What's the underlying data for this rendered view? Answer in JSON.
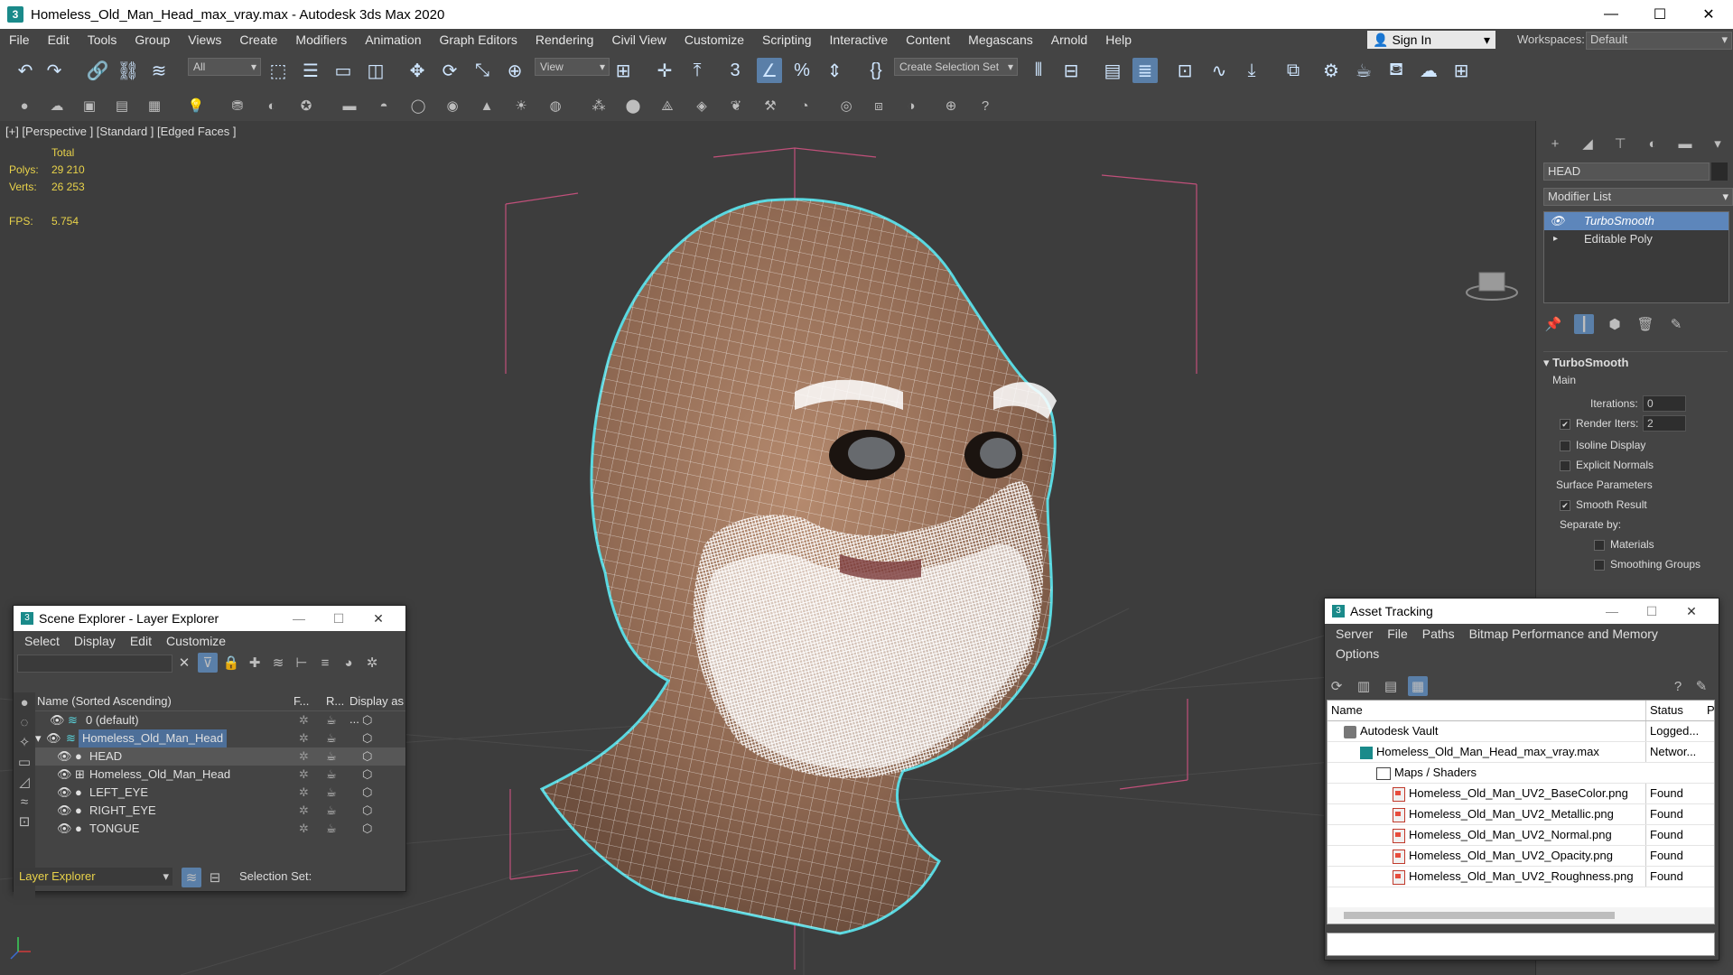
{
  "window": {
    "title": "Homeless_Old_Man_Head_max_vray.max - Autodesk 3ds Max 2020",
    "app_icon": "3",
    "minimize": "—",
    "maximize": "☐",
    "close": "✕"
  },
  "menu": {
    "items": [
      "File",
      "Edit",
      "Tools",
      "Group",
      "Views",
      "Create",
      "Modifiers",
      "Animation",
      "Graph Editors",
      "Rendering",
      "Civil View",
      "Customize",
      "Scripting",
      "Interactive",
      "Content",
      "Megascans",
      "Arnold",
      "Help"
    ],
    "sign_in": "Sign In",
    "workspaces_label": "Workspaces:",
    "workspace_value": "Default"
  },
  "toolbar": {
    "filter_value": "All",
    "refcoord_value": "View",
    "selection_set_value": "Create Selection Set"
  },
  "viewport": {
    "label": "[+] [Perspective ] [Standard ] [Edged Faces ]",
    "stats_total": "Total",
    "polys_label": "Polys:",
    "polys_value": "29 210",
    "verts_label": "Verts:",
    "verts_value": "26 253",
    "fps_label": "FPS:",
    "fps_value": "5.754"
  },
  "command_panel": {
    "object_name": "HEAD",
    "modifier_list": "Modifier List",
    "stack": [
      {
        "label": "TurboSmooth",
        "selected": true
      },
      {
        "label": "Editable Poly",
        "selected": false
      }
    ],
    "rollout_title": "TurboSmooth",
    "main_label": "Main",
    "iterations_label": "Iterations:",
    "iterations_value": "0",
    "render_iters_label": "Render Iters:",
    "render_iters_value": "2",
    "isoline_label": "Isoline Display",
    "explicit_normals_label": "Explicit Normals",
    "surface_params_label": "Surface Parameters",
    "smooth_result_label": "Smooth Result",
    "separate_by_label": "Separate by:",
    "materials_label": "Materials",
    "smoothing_groups_label": "Smoothing Groups"
  },
  "scene_explorer": {
    "title": "Scene Explorer - Layer Explorer",
    "menu": [
      "Select",
      "Display",
      "Edit",
      "Customize"
    ],
    "col_name": "Name (Sorted Ascending)",
    "col_f": "F...",
    "col_r": "R...",
    "col_display": "Display as ...",
    "rows": [
      {
        "name": "0 (default)",
        "indent": 1,
        "selected": false
      },
      {
        "name": "Homeless_Old_Man_Head",
        "indent": 1,
        "selected": true
      },
      {
        "name": "HEAD",
        "indent": 2,
        "selected": true
      },
      {
        "name": "Homeless_Old_Man_Head",
        "indent": 2,
        "selected": false
      },
      {
        "name": "LEFT_EYE",
        "indent": 2,
        "selected": false
      },
      {
        "name": "RIGHT_EYE",
        "indent": 2,
        "selected": false
      },
      {
        "name": "TONGUE",
        "indent": 2,
        "selected": false
      }
    ],
    "explorer_dropdown": "Layer Explorer",
    "selection_set_label": "Selection Set:"
  },
  "asset_tracking": {
    "title": "Asset Tracking",
    "menu": [
      "Server",
      "File",
      "Paths",
      "Bitmap Performance and Memory"
    ],
    "menu2": "Options",
    "col_name": "Name",
    "col_status": "Status",
    "col_p": "P",
    "rows": [
      {
        "name": "Autodesk Vault",
        "status": "Logged...",
        "icon": "vault-icon",
        "indent": 1
      },
      {
        "name": "Homeless_Old_Man_Head_max_vray.max",
        "status": "Networ...",
        "icon": "max-file-icon",
        "indent": 2
      },
      {
        "name": "Maps / Shaders",
        "status": "",
        "icon": "folder-icon",
        "indent": 3
      },
      {
        "name": "Homeless_Old_Man_UV2_BaseColor.png",
        "status": "Found",
        "icon": "png-file-icon",
        "indent": 4
      },
      {
        "name": "Homeless_Old_Man_UV2_Metallic.png",
        "status": "Found",
        "icon": "png-file-icon",
        "indent": 4
      },
      {
        "name": "Homeless_Old_Man_UV2_Normal.png",
        "status": "Found",
        "icon": "png-file-icon",
        "indent": 4
      },
      {
        "name": "Homeless_Old_Man_UV2_Opacity.png",
        "status": "Found",
        "icon": "png-file-icon",
        "indent": 4
      },
      {
        "name": "Homeless_Old_Man_UV2_Roughness.png",
        "status": "Found",
        "icon": "png-file-icon",
        "indent": 4
      }
    ]
  },
  "colors": {
    "selection_blue": "#5d86bb",
    "stats_yellow": "#e8d24a",
    "wire_cyan": "#5ad8e0",
    "bbox_pink": "#c0507a"
  }
}
